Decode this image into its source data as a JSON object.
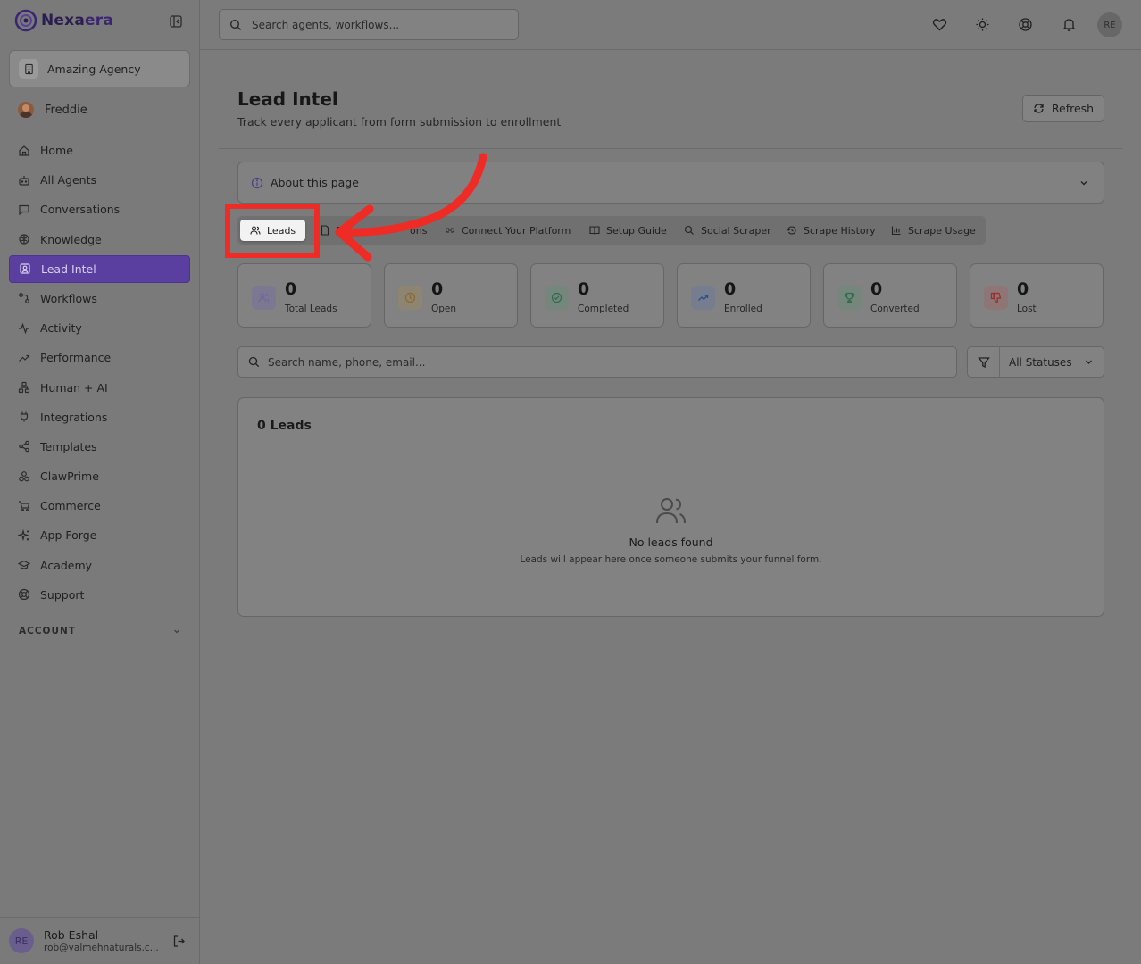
{
  "brand": {
    "name_part1": "Nexa",
    "name_part2": "era"
  },
  "sidebar": {
    "agency": "Amazing Agency",
    "user": "Freddie",
    "items": [
      {
        "label": "Home",
        "icon": "home-icon"
      },
      {
        "label": "All Agents",
        "icon": "bot-icon"
      },
      {
        "label": "Conversations",
        "icon": "message-icon"
      },
      {
        "label": "Knowledge",
        "icon": "brain-icon"
      },
      {
        "label": "Lead Intel",
        "icon": "contact-icon"
      },
      {
        "label": "Workflows",
        "icon": "workflow-icon"
      },
      {
        "label": "Activity",
        "icon": "activity-icon"
      },
      {
        "label": "Performance",
        "icon": "trending-up-icon"
      },
      {
        "label": "Human + AI",
        "icon": "network-icon"
      },
      {
        "label": "Integrations",
        "icon": "plug-icon"
      },
      {
        "label": "Templates",
        "icon": "share-icon"
      },
      {
        "label": "ClawPrime",
        "icon": "cluster-icon"
      },
      {
        "label": "Commerce",
        "icon": "cart-icon"
      },
      {
        "label": "App Forge",
        "icon": "sparkles-icon"
      },
      {
        "label": "Academy",
        "icon": "graduation-cap-icon"
      },
      {
        "label": "Support",
        "icon": "lifebuoy-icon"
      }
    ],
    "account_label": "ACCOUNT",
    "bottom_user": {
      "initials": "RE",
      "name": "Rob Eshal",
      "email": "rob@yalmehnaturals.c..."
    }
  },
  "topbar": {
    "search_placeholder": "Search agents, workflows...",
    "avatar_initials": "RE"
  },
  "page": {
    "title": "Lead Intel",
    "subtitle": "Track every applicant from form submission to enrollment",
    "refresh_label": "Refresh",
    "about_label": "About this page"
  },
  "tabs": [
    {
      "label": "Leads",
      "icon": "users-icon"
    },
    {
      "label": "F",
      "icon": "file-icon"
    },
    {
      "label": "ons",
      "icon": ""
    },
    {
      "label": "Connect Your Platform",
      "icon": "link-icon"
    },
    {
      "label": "Setup Guide",
      "icon": "book-icon"
    },
    {
      "label": "Social Scraper",
      "icon": "search-icon"
    },
    {
      "label": "Scrape History",
      "icon": "history-icon"
    },
    {
      "label": "Scrape Usage",
      "icon": "bar-chart-icon"
    }
  ],
  "stats": [
    {
      "value": "0",
      "label": "Total Leads",
      "color": "#6f63a0",
      "bg": "#7d7891"
    },
    {
      "value": "0",
      "label": "Open",
      "color": "#8a6a2a",
      "bg": "#8d8471"
    },
    {
      "value": "0",
      "label": "Completed",
      "color": "#2f6b4a",
      "bg": "#75877c"
    },
    {
      "value": "0",
      "label": "Enrolled",
      "color": "#2a4e8a",
      "bg": "#767d8e"
    },
    {
      "value": "0",
      "label": "Converted",
      "color": "#2f6b4a",
      "bg": "#75877c"
    },
    {
      "value": "0",
      "label": "Lost",
      "color": "#9a2e2e",
      "bg": "#8e7676"
    }
  ],
  "filters": {
    "search_placeholder": "Search name, phone, email...",
    "status_value": "All Statuses"
  },
  "leads": {
    "title": "0 Leads",
    "empty_title": "No leads found",
    "empty_subtitle": "Leads will appear here once someone submits your funnel form."
  },
  "colors": {
    "accent": "#5b3fa0",
    "annotation": "#ee2b24"
  }
}
